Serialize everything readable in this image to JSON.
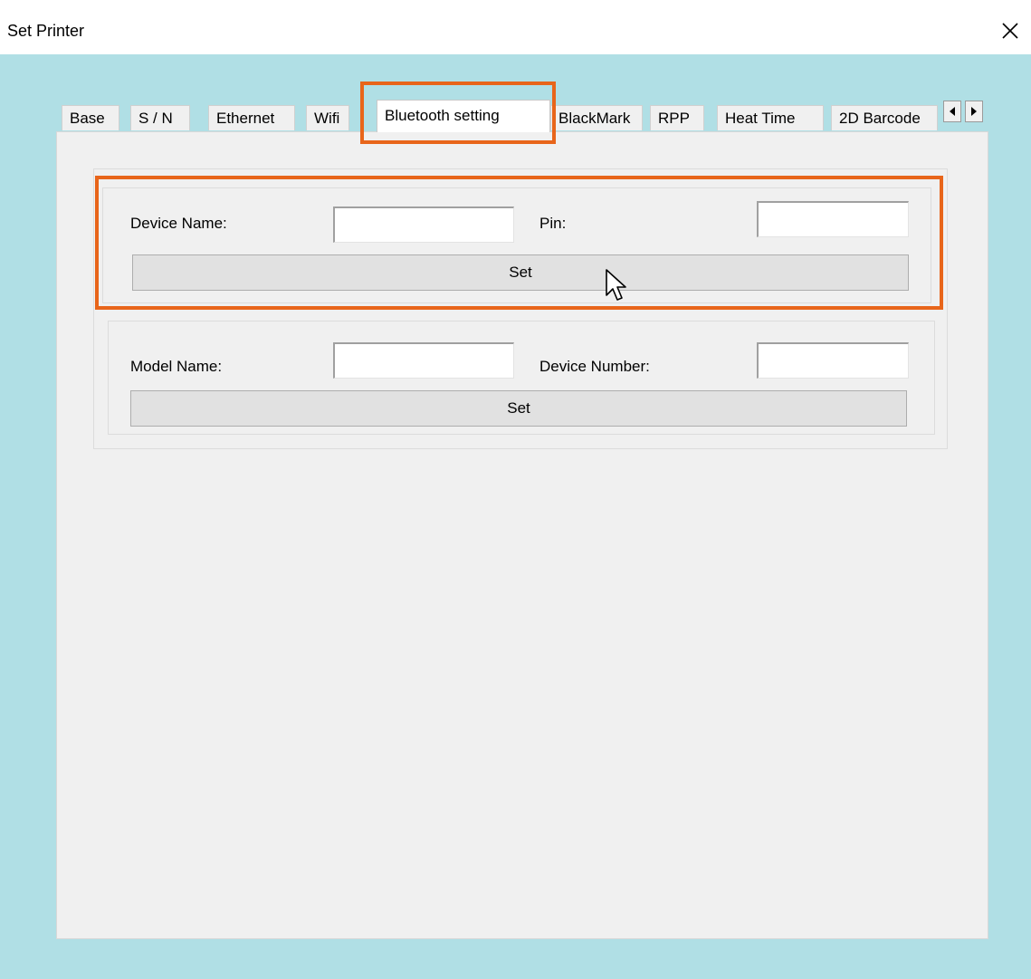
{
  "window": {
    "title": "Set Printer"
  },
  "icons": {
    "close": "close-icon",
    "tab_scroll_left": "triangle-left-icon",
    "tab_scroll_right": "triangle-right-icon",
    "cursor": "mouse-pointer-icon"
  },
  "tabs": [
    {
      "label": "Base",
      "active": false
    },
    {
      "label": "S / N",
      "active": false
    },
    {
      "label": "Ethernet",
      "active": false
    },
    {
      "label": "Wifi",
      "active": false
    },
    {
      "label": "Bluetooth setting",
      "active": true
    },
    {
      "label": "BlackMark",
      "active": false
    },
    {
      "label": "RPP",
      "active": false
    },
    {
      "label": "Heat Time",
      "active": false
    },
    {
      "label": "2D Barcode",
      "active": false
    }
  ],
  "bluetooth": {
    "group1": {
      "device_name_label": "Device Name:",
      "device_name_value": "",
      "pin_label": "Pin:",
      "pin_value": "",
      "set_label": "Set"
    },
    "group2": {
      "model_name_label": "Model Name:",
      "model_name_value": "",
      "device_number_label": "Device Number:",
      "device_number_value": "",
      "set_label": "Set"
    }
  },
  "colors": {
    "highlight": "#e8651a",
    "window_background": "#b0dfe5",
    "panel_background": "#f0f0f0"
  }
}
